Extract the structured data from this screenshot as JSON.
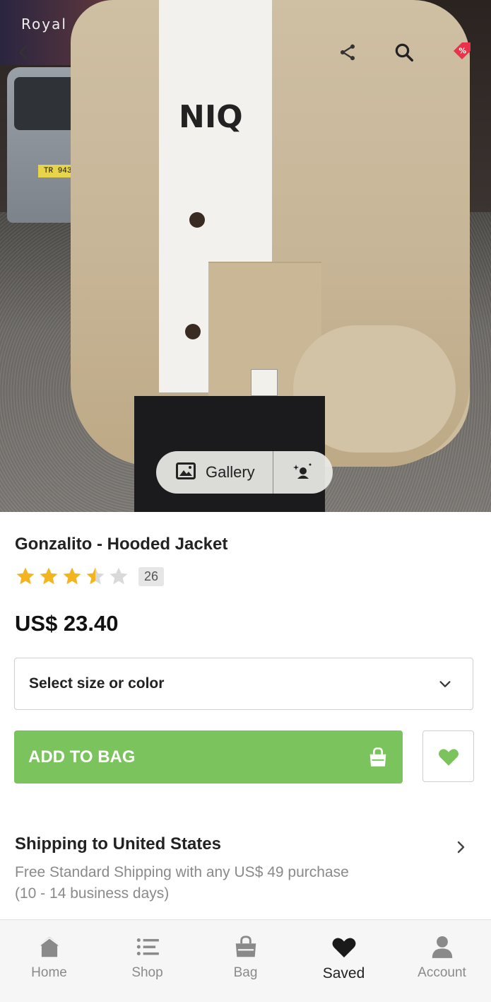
{
  "hero": {
    "sign_text": "Royal",
    "plate_text": "TR 9436",
    "shirt_text": "NIQ",
    "gallery_label": "Gallery",
    "icons": [
      "back-arrow-icon",
      "share-icon",
      "search-icon",
      "discount-tag-icon",
      "image-icon",
      "try-on-icon"
    ]
  },
  "product": {
    "title": "Gonzalito - Hooded Jacket",
    "rating": 3.5,
    "rating_max": 5,
    "review_count": "26",
    "price": "US$ 23.40"
  },
  "select": {
    "label": "Select size or color"
  },
  "actions": {
    "add_to_bag": "ADD TO BAG"
  },
  "shipping": {
    "title": "Shipping to United States",
    "line1": "Free Standard Shipping with any US$ 49 purchase",
    "line2": "(10 - 14 business days)"
  },
  "nav": {
    "home": "Home",
    "shop": "Shop",
    "bag": "Bag",
    "saved": "Saved",
    "account": "Account"
  },
  "colors": {
    "accent_green": "#7ac35d",
    "star_gold": "#f2b51f",
    "star_empty": "#d9d9d9",
    "discount_red": "#e8334a"
  }
}
